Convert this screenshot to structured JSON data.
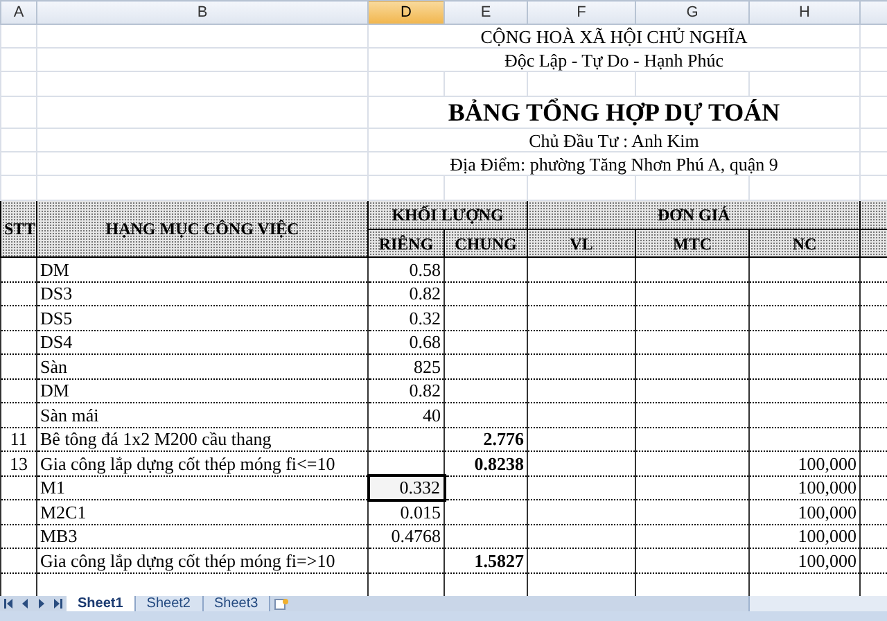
{
  "columns": [
    {
      "label": "A",
      "selected": false
    },
    {
      "label": "B",
      "selected": false
    },
    {
      "label": "D",
      "selected": true
    },
    {
      "label": "E",
      "selected": false
    },
    {
      "label": "F",
      "selected": false
    },
    {
      "label": "G",
      "selected": false
    },
    {
      "label": "H",
      "selected": false
    }
  ],
  "title_lines": [
    {
      "kind": "motto",
      "text": "CỘNG HOÀ XÃ HỘI CHỦ NGHĨA"
    },
    {
      "kind": "motto",
      "text": "Độc Lập - Tự Do - Hạnh Phúc"
    },
    {
      "kind": "gap"
    },
    {
      "kind": "heading",
      "text": "BẢNG TỔNG HỢP DỰ TOÁN"
    },
    {
      "kind": "info",
      "text": "Chủ Đầu Tư : Anh Kim"
    },
    {
      "kind": "info",
      "text": "Địa Điểm: phường Tăng Nhơn Phú A, quận 9"
    },
    {
      "kind": "gap"
    }
  ],
  "header": {
    "stt": "STT",
    "item": "HẠNG MỤC CÔNG VIỆC",
    "quantity": "KHỐI LƯỢNG",
    "unit_price": "ĐƠN GIÁ",
    "sub": [
      "RIÊNG",
      "CHUNG",
      "VL",
      "MTC",
      "NC"
    ]
  },
  "rows": [
    {
      "stt": "",
      "item": "DM",
      "rieng": "0.58",
      "chung": "",
      "nc": "",
      "rieng_active": false
    },
    {
      "stt": "",
      "item": "DS3",
      "rieng": "0.82",
      "chung": "",
      "nc": "",
      "rieng_active": false
    },
    {
      "stt": "",
      "item": "DS5",
      "rieng": "0.32",
      "chung": "",
      "nc": "",
      "rieng_active": false
    },
    {
      "stt": "",
      "item": "DS4",
      "rieng": "0.68",
      "chung": "",
      "nc": "",
      "rieng_active": false
    },
    {
      "stt": "",
      "item": "Sàn",
      "rieng": "825",
      "chung": "",
      "nc": "",
      "rieng_active": false
    },
    {
      "stt": "",
      "item": "DM",
      "rieng": "0.82",
      "chung": "",
      "nc": "",
      "rieng_active": false
    },
    {
      "stt": "",
      "item": "Sàn mái",
      "rieng": "40",
      "chung": "",
      "nc": "",
      "rieng_active": false
    },
    {
      "stt": "11",
      "item": "Bê tông đá 1x2 M200 cầu thang",
      "rieng": "",
      "chung": "2.776",
      "nc": "",
      "rieng_active": false
    },
    {
      "stt": "13",
      "item": "Gia công lắp dựng cốt thép móng fi<=10",
      "rieng": "",
      "chung": "0.8238",
      "nc": "100,000",
      "rieng_active": false
    },
    {
      "stt": "",
      "item": "M1",
      "rieng": "0.332",
      "chung": "",
      "nc": "100,000",
      "rieng_active": true
    },
    {
      "stt": "",
      "item": "M2C1",
      "rieng": "0.015",
      "chung": "",
      "nc": "100,000",
      "rieng_active": false
    },
    {
      "stt": "",
      "item": "MB3",
      "rieng": "0.4768",
      "chung": "",
      "nc": "100,000",
      "rieng_active": false
    },
    {
      "stt": "",
      "item": "Gia công lắp dựng cốt thép móng fi=>10",
      "rieng": "",
      "chung": "1.5827",
      "nc": "100,000",
      "rieng_active": false
    }
  ],
  "sheet_tabs": [
    {
      "label": "Sheet1",
      "selected": true
    },
    {
      "label": "Sheet2",
      "selected": false
    },
    {
      "label": "Sheet3",
      "selected": false
    }
  ]
}
